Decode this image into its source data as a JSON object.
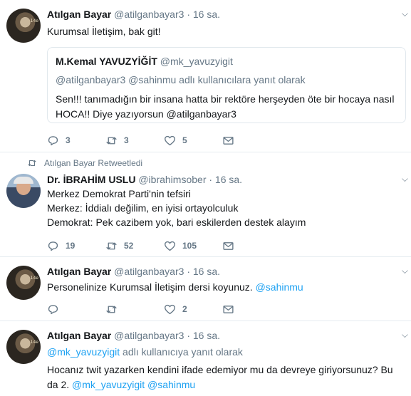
{
  "tweets": [
    {
      "name": "Atılgan Bayar",
      "handle": "@atilganbayar3",
      "time": "· 16 sa.",
      "text": "Kurumsal İletişim, bak git!",
      "quote": {
        "name": "M.Kemal YAVUZYİĞİT",
        "handle": "@mk_yavuzyigit",
        "reply_to": "@atilganbayar3 @sahinmu adlı kullanıcılara yanıt olarak",
        "text": "Sen!!! tanımadığın bir insana hatta bir rektöre herşeyden öte bir hocaya nasıl HOCA!! Diye yazıyorsun @atilganbayar3"
      },
      "replies": "3",
      "retweets": "3",
      "likes": "5"
    },
    {
      "retweeted_by": "Atılgan Bayar Retweetledi",
      "name": "Dr. İBRAHİM USLU",
      "handle": "@ibrahimsober",
      "time": "· 16 sa.",
      "lines": [
        "Merkez Demokrat Parti'nin tefsiri",
        "Merkez: İddialı değilim, en iyisi ortayolculuk",
        "Demokrat: Pek cazibem yok, bari eskilerden destek alayım"
      ],
      "replies": "19",
      "retweets": "52",
      "likes": "105"
    },
    {
      "name": "Atılgan Bayar",
      "handle": "@atilganbayar3",
      "time": "· 16 sa.",
      "text": "Personelinize Kurumsal İletişim dersi koyunuz.",
      "mention": "@sahinmu",
      "replies": "",
      "retweets": "",
      "likes": "2"
    },
    {
      "name": "Atılgan Bayar",
      "handle": "@atilganbayar3",
      "time": "· 16 sa.",
      "reply_mention": "@mk_yavuzyigit",
      "reply_suffix": "adlı kullanıcıya yanıt olarak",
      "text": "Hocanız twit yazarken kendini ifade edemiyor mu da devreye giriyorsunuz? Bu da 2.",
      "mentions": "@mk_yavuzyigit @sahinmu"
    }
  ],
  "avatar_badge": "14e"
}
